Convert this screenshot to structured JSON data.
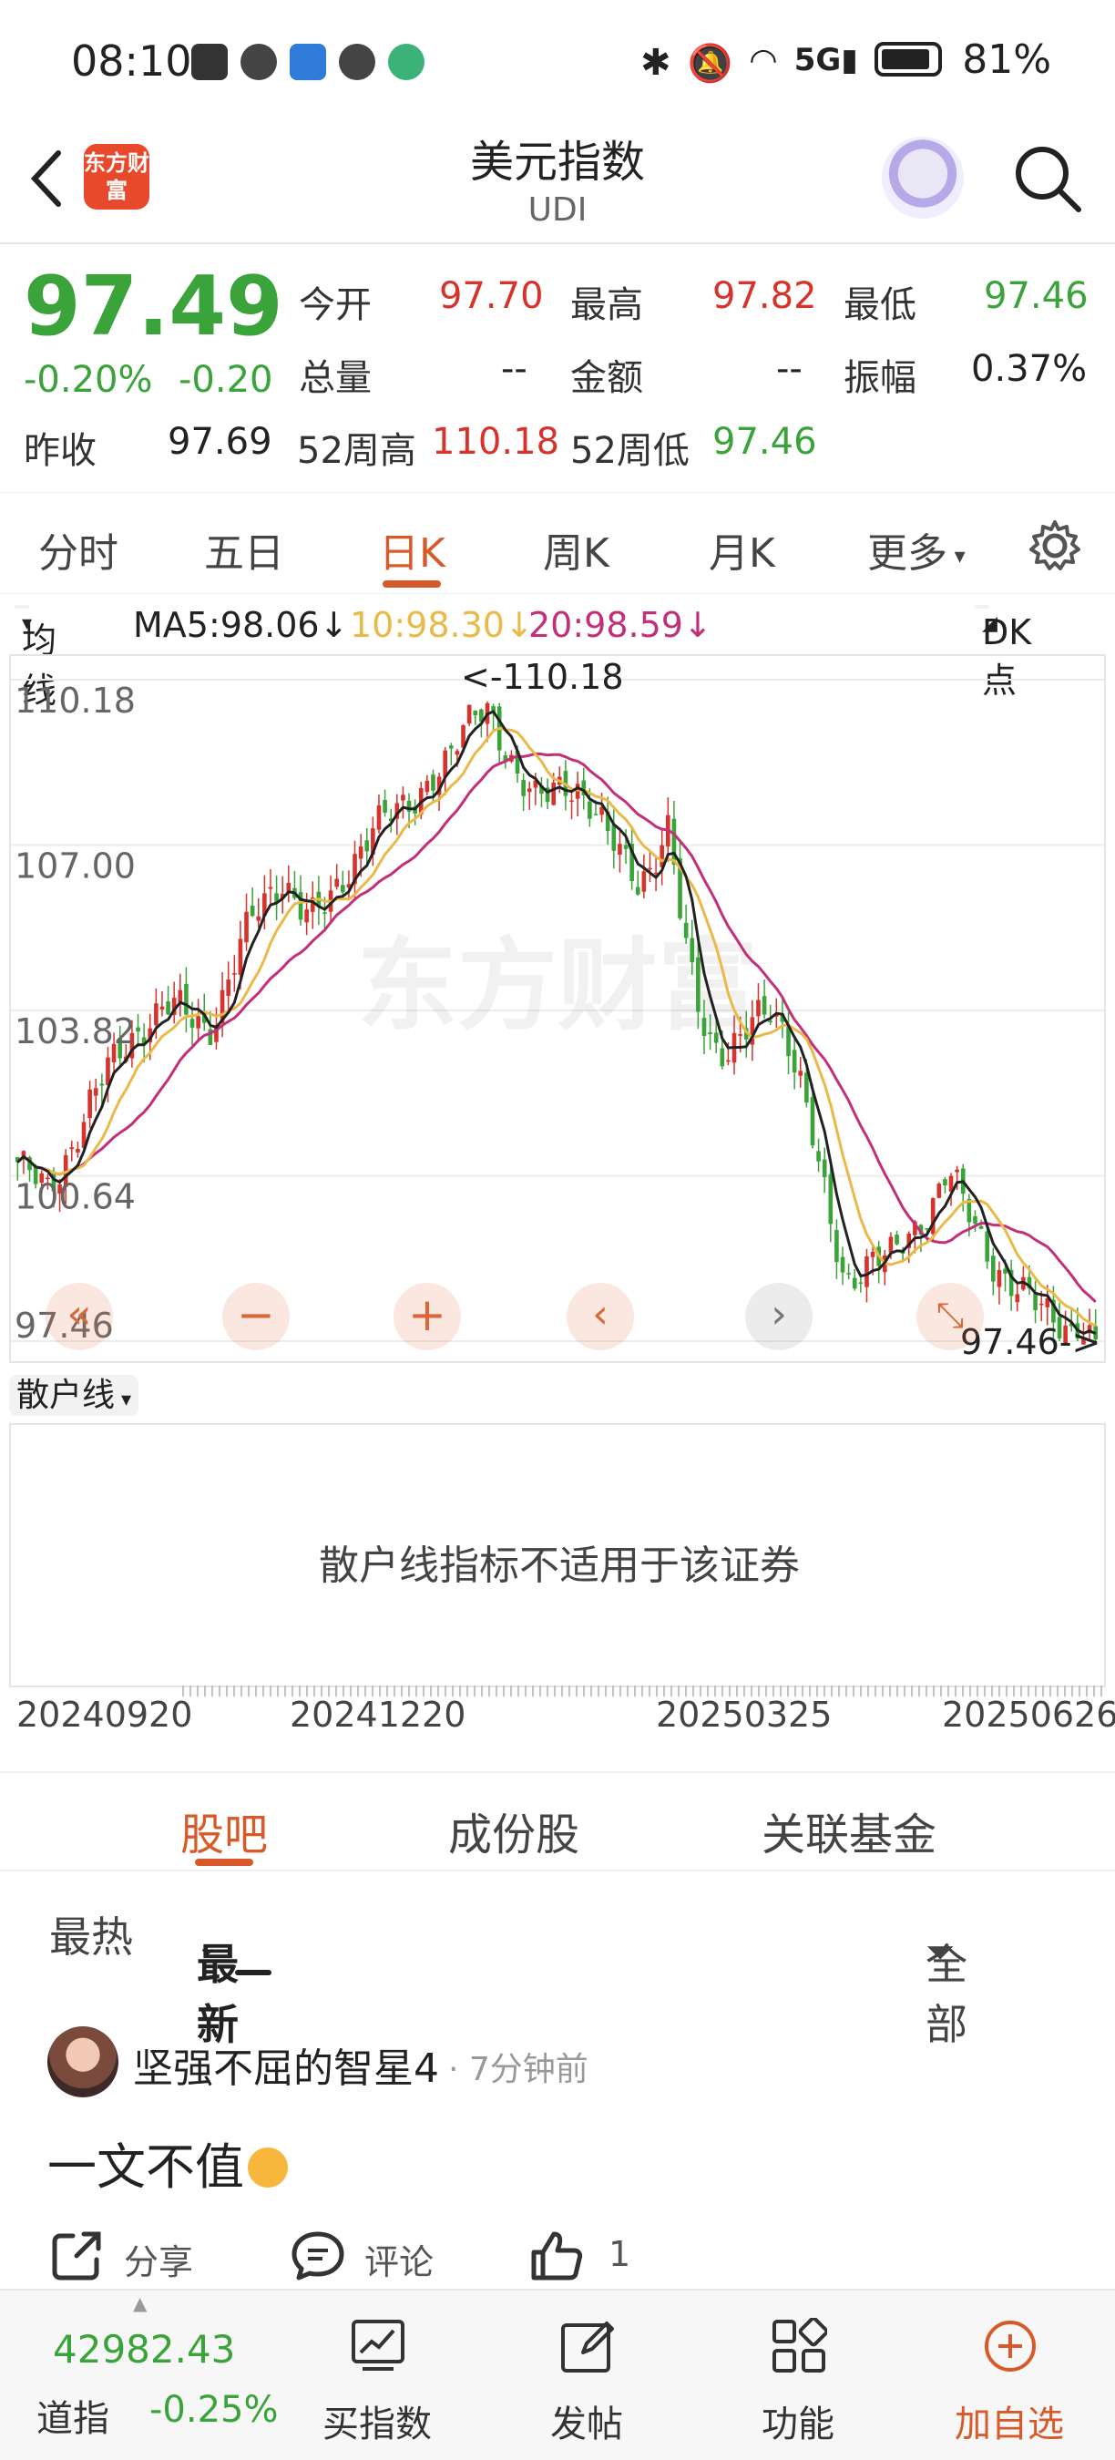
{
  "status_bar": {
    "time": "08:10",
    "battery": "81%"
  },
  "header": {
    "title": "美元指数",
    "subtitle": "UDI",
    "logo_text": "东方财富"
  },
  "quote": {
    "price": "97.49",
    "change_pct": "-0.20%",
    "change": "-0.20",
    "prev_close_label": "昨收",
    "prev_close": "97.69",
    "open_label": "今开",
    "open": "97.70",
    "high_label": "最高",
    "high": "97.82",
    "low_label": "最低",
    "low": "97.46",
    "volume_label": "总量",
    "volume": "--",
    "amount_label": "金额",
    "amount": "--",
    "amplitude_label": "振幅",
    "amplitude": "0.37%",
    "w52_high_label": "52周高",
    "w52_high": "110.18",
    "w52_low_label": "52周低",
    "w52_low": "97.46"
  },
  "ktabs": [
    "分时",
    "五日",
    "日K",
    "周K",
    "月K",
    "更多"
  ],
  "ma": {
    "selector": "均线",
    "ma5": "MA5:98.06↓",
    "ma10": "10:98.30↓",
    "ma20": "20:98.59↓",
    "dk": "DK点"
  },
  "chart_data": {
    "type": "candlestick",
    "y_ticks": [
      "110.18",
      "107.00",
      "103.82",
      "100.64",
      "97.46"
    ],
    "ylim": [
      97.46,
      110.18
    ],
    "max_annotation": "<-110.18",
    "min_annotation": "97.46->",
    "x_ticks": [
      "20240920",
      "20241220",
      "20250325",
      "20250626"
    ],
    "watermark": "东方财富",
    "series_colors": {
      "ma5": "#222222",
      "ma10": "#e9b949",
      "ma20": "#c2307a"
    },
    "close_path": [
      100.9,
      100.6,
      100.3,
      100.8,
      101.5,
      102.1,
      102.6,
      103.0,
      103.4,
      103.7,
      103.9,
      103.8,
      103.6,
      103.5,
      104.2,
      105.0,
      105.6,
      106.0,
      106.4,
      105.9,
      105.6,
      105.8,
      106.3,
      106.9,
      107.4,
      107.5,
      107.6,
      107.9,
      108.4,
      108.6,
      109.0,
      109.5,
      109.7,
      108.9,
      108.2,
      107.8,
      108.0,
      108.3,
      108.1,
      107.6,
      107.1,
      106.8,
      106.4,
      106.6,
      107.3,
      105.4,
      104.0,
      103.3,
      103.0,
      103.2,
      103.6,
      103.9,
      103.5,
      102.5,
      101.1,
      99.7,
      98.6,
      98.9,
      99.1,
      99.0,
      99.3,
      99.7,
      100.2,
      100.8,
      100.1,
      99.5,
      99.0,
      98.7,
      98.4,
      98.1,
      97.9,
      97.8,
      97.6,
      97.5
    ]
  },
  "indicator": {
    "selector": "散户线",
    "message": "散户线指标不适用于该证券"
  },
  "sections": [
    "股吧",
    "成份股",
    "关联基金"
  ],
  "sort": {
    "hot": "最热",
    "latest": "最新",
    "filter": "全部"
  },
  "post": {
    "user": "坚强不屈的智星4",
    "time": "· 7分钟前",
    "text": "一文不值",
    "share": "分享",
    "comment": "评论",
    "likes": "1"
  },
  "bottom_nav": {
    "index_value": "42982.43",
    "index_name": "道指",
    "index_change": "-0.25%",
    "buy": "买指数",
    "post": "发帖",
    "functions": "功能",
    "add_watch": "加自选"
  }
}
